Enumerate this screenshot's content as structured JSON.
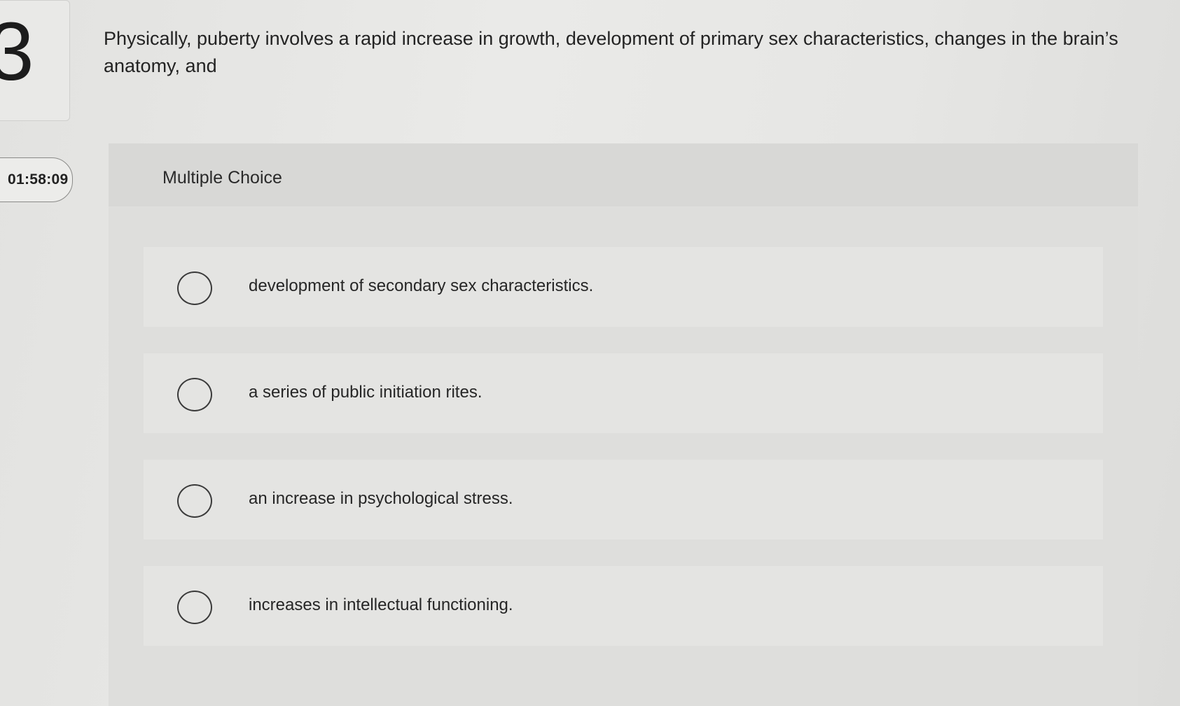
{
  "question": {
    "number": "3",
    "timer": "01:58:09",
    "prompt": "Physically, puberty involves a rapid increase in growth, development of primary sex characteristics, changes in the brain’s anatomy, and",
    "type_label": "Multiple Choice"
  },
  "options": [
    {
      "label": "development of secondary sex characteristics."
    },
    {
      "label": "a series of public initiation rites."
    },
    {
      "label": "an increase in psychological stress."
    },
    {
      "label": "increases in intellectual functioning."
    }
  ]
}
